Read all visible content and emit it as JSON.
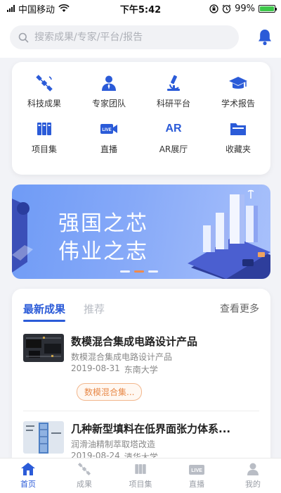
{
  "status_bar": {
    "carrier": "中国移动",
    "time": "下午5:42",
    "battery": "99%",
    "battery_level": 0.99
  },
  "search": {
    "placeholder": "搜索成果/专家/平台/报告"
  },
  "menu": [
    {
      "label": "科技成果",
      "icon": "satellite-icon"
    },
    {
      "label": "专家团队",
      "icon": "expert-icon"
    },
    {
      "label": "科研平台",
      "icon": "microscope-icon"
    },
    {
      "label": "学术报告",
      "icon": "graduation-cap-icon"
    },
    {
      "label": "项目集",
      "icon": "binders-icon"
    },
    {
      "label": "直播",
      "icon": "live-camera-icon"
    },
    {
      "label": "AR展厅",
      "icon": "ar-icon",
      "icon_text": "AR"
    },
    {
      "label": "收藏夹",
      "icon": "folder-icon"
    }
  ],
  "banner": {
    "line1": "强国之芯",
    "line2": "伟业之志",
    "active_slide": 2,
    "slide_count": 3
  },
  "feed": {
    "tabs": [
      "最新成果",
      "推荐"
    ],
    "more": "查看更多",
    "items": [
      {
        "title": "数模混合集成电路设计产品",
        "subtitle": "数模混合集成电路设计产品",
        "date": "2019-08-31",
        "org": "东南大学",
        "tag": "数模混合集..."
      },
      {
        "title": "几种新型填料在低界面张力体系...",
        "subtitle": "润滑油精制萃取塔改造",
        "date": "2019-08-24",
        "org": "清华大学"
      }
    ]
  },
  "tabbar": [
    {
      "label": "首页",
      "icon": "home-icon"
    },
    {
      "label": "成果",
      "icon": "satellite-icon"
    },
    {
      "label": "项目集",
      "icon": "binders-icon"
    },
    {
      "label": "直播",
      "icon": "live-icon"
    },
    {
      "label": "我的",
      "icon": "user-icon"
    }
  ],
  "colors": {
    "accent": "#2b5bd8",
    "tag_orange": "#e88a4a",
    "active_dot": "#f08a4b"
  }
}
